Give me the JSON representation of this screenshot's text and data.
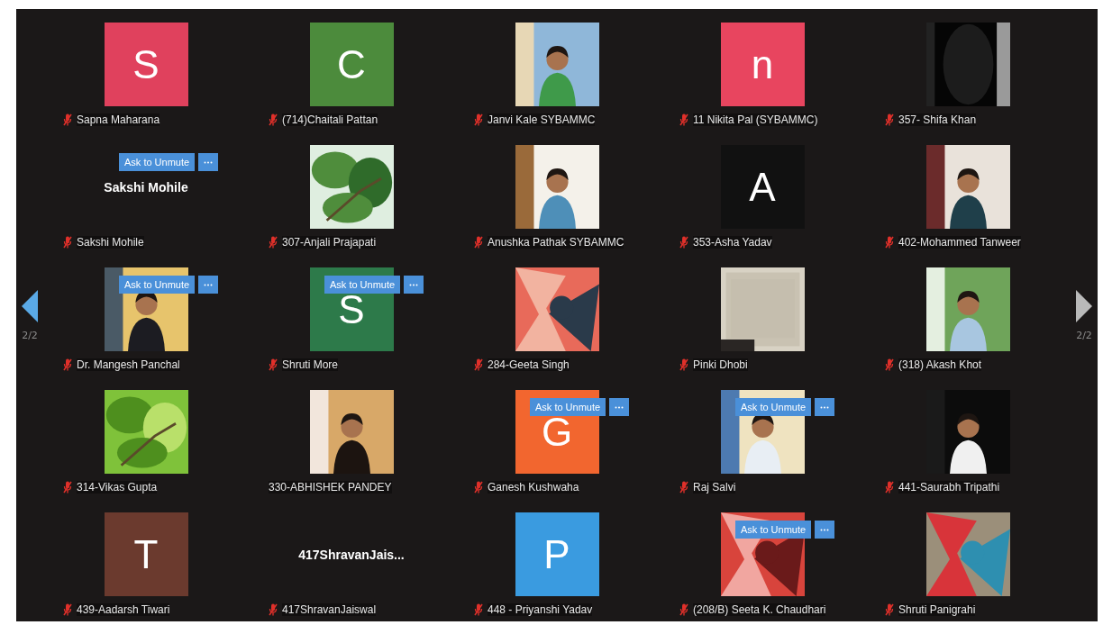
{
  "pager": {
    "previous_label": "2/2",
    "next_label": "2/2"
  },
  "tiles": [
    {
      "name": "Sapna Maharana",
      "kind": "initial",
      "letter": "S",
      "color": "#e0415d",
      "muted": true
    },
    {
      "name": "(714)Chaitali Pattan",
      "kind": "initial",
      "letter": "C",
      "color": "#4c8b3c",
      "muted": true
    },
    {
      "name": "Janvi Kale SYBAMMC",
      "kind": "picture",
      "muted": true
    },
    {
      "name": "11 Nikita Pal (SYBAMMC)",
      "kind": "initial",
      "letter": "n",
      "color": "#e8455f",
      "muted": true
    },
    {
      "name": "357- Shifa Khan",
      "kind": "picture",
      "muted": true
    },
    {
      "name": "Sakshi Mohile",
      "kind": "name",
      "display": "Sakshi Mohile",
      "muted": true,
      "ask_to_unmute": "Ask to Unmute"
    },
    {
      "name": "307-Anjali Prajapati",
      "kind": "picture",
      "muted": true
    },
    {
      "name": "Anushka Pathak SYBAMMC",
      "kind": "picture",
      "muted": true
    },
    {
      "name": "353-Asha Yadav",
      "kind": "initial",
      "letter": "A",
      "color": "#111111",
      "muted": true
    },
    {
      "name": "402-Mohammed Tanweer",
      "kind": "picture",
      "muted": true
    },
    {
      "name": "Dr. Mangesh Panchal",
      "kind": "picture",
      "muted": true,
      "ask_to_unmute": "Ask to Unmute"
    },
    {
      "name": "Shruti More",
      "kind": "initial",
      "letter": "S",
      "color": "#2d7a4a",
      "muted": true,
      "ask_to_unmute": "Ask to Unmute"
    },
    {
      "name": "284-Geeta Singh",
      "kind": "picture",
      "muted": true
    },
    {
      "name": "Pinki Dhobi",
      "kind": "picture",
      "muted": true
    },
    {
      "name": "(318) Akash Khot",
      "kind": "picture",
      "muted": true
    },
    {
      "name": "314-Vikas Gupta",
      "kind": "picture",
      "muted": true
    },
    {
      "name": "330-ABHISHEK PANDEY",
      "kind": "picture",
      "muted": false
    },
    {
      "name": "Ganesh Kushwaha",
      "kind": "initial",
      "letter": "G",
      "color": "#f2662f",
      "muted": true,
      "ask_to_unmute": "Ask to Unmute"
    },
    {
      "name": "Raj Salvi",
      "kind": "picture",
      "muted": true,
      "ask_to_unmute": "Ask to Unmute"
    },
    {
      "name": "441-Saurabh Tripathi",
      "kind": "picture",
      "muted": true
    },
    {
      "name": "439-Aadarsh Tiwari",
      "kind": "initial",
      "letter": "T",
      "color": "#6b3a2e",
      "muted": true
    },
    {
      "name": "417ShravanJaiswal",
      "kind": "name",
      "display": "417ShravanJais...",
      "muted": true
    },
    {
      "name": "448 - Priyanshi Yadav",
      "kind": "initial",
      "letter": "P",
      "color": "#3a9be0",
      "muted": true
    },
    {
      "name": "(208/B) Seeta K. Chaudhari",
      "kind": "picture",
      "muted": true,
      "ask_to_unmute": "Ask to Unmute"
    },
    {
      "name": "Shruti Panigrahi",
      "kind": "picture",
      "muted": true
    }
  ]
}
